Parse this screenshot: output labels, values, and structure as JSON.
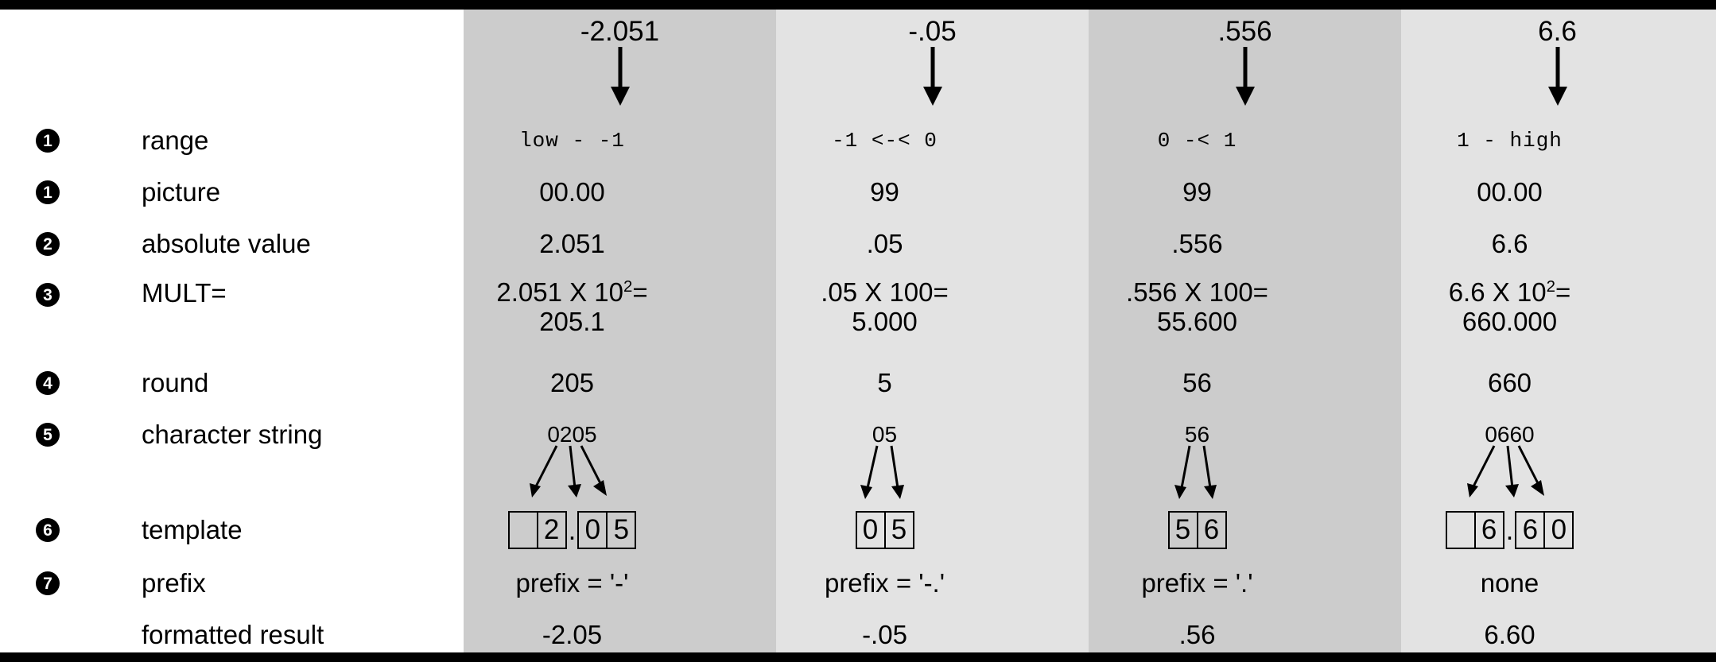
{
  "figure": {
    "columns": [
      {
        "header_value": "-2.051",
        "range": "low - -1",
        "picture": "00.00",
        "absolute_value": "2.051",
        "mult_expr": "2.051 X 10",
        "mult_exp": "2",
        "mult_eq": "=",
        "mult_result": "205.1",
        "round": "205",
        "character_string": "0205",
        "template_boxes": [
          "",
          "2",
          ".",
          "0",
          "5"
        ],
        "prefix": "prefix = '-'",
        "formatted_result": "-2.05",
        "band_color": "#cccccc"
      },
      {
        "header_value": "-.05",
        "range": "-1 <-< 0",
        "picture": "99",
        "absolute_value": ".05",
        "mult_expr": ".05 X 100",
        "mult_exp": "",
        "mult_eq": "=",
        "mult_result": "5.000",
        "round": "5",
        "character_string": "05",
        "template_boxes": [
          "0",
          "5"
        ],
        "prefix": "prefix = '-.'",
        "formatted_result": "-.05",
        "band_color": "#e3e3e3"
      },
      {
        "header_value": ".556",
        "range": "0 -< 1",
        "picture": "99",
        "absolute_value": ".556",
        "mult_expr": ".556 X 100",
        "mult_exp": "",
        "mult_eq": "=",
        "mult_result": "55.600",
        "round": "56",
        "character_string": "56",
        "template_boxes": [
          "5",
          "6"
        ],
        "prefix": "prefix = '.'",
        "formatted_result": ".56",
        "band_color": "#cccccc"
      },
      {
        "header_value": "6.6",
        "range": "1 - high",
        "picture": "00.00",
        "absolute_value": "6.6",
        "mult_expr": "6.6 X 10",
        "mult_exp": "2",
        "mult_eq": "=",
        "mult_result": "660.000",
        "round": "660",
        "character_string": "0660",
        "template_boxes": [
          "",
          "6",
          ".",
          "6",
          "0"
        ],
        "prefix": "none",
        "formatted_result": "6.60",
        "band_color": "#e3e3e3"
      }
    ],
    "rows": [
      {
        "bullet": "1",
        "label": "range"
      },
      {
        "bullet": "1",
        "label": "picture"
      },
      {
        "bullet": "2",
        "label": "absolute value"
      },
      {
        "bullet": "3",
        "label": "MULT="
      },
      {
        "bullet": "4",
        "label": "round"
      },
      {
        "bullet": "5",
        "label": "character string"
      },
      {
        "bullet": "6",
        "label": "template"
      },
      {
        "bullet": "7",
        "label": "prefix"
      },
      {
        "bullet": "",
        "label": "formatted result"
      }
    ]
  }
}
